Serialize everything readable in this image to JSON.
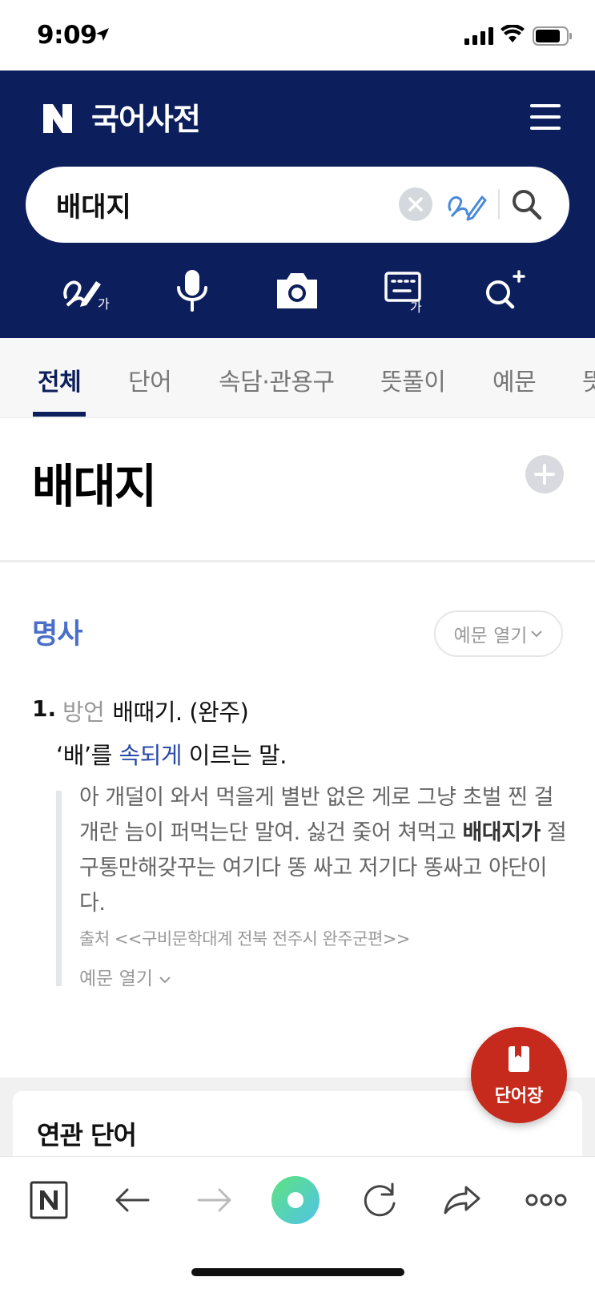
{
  "status": {
    "time": "9:09"
  },
  "header": {
    "logo": "N",
    "title": "국어사전",
    "search": {
      "value": "배대지"
    }
  },
  "tabs": [
    "전체",
    "단어",
    "속담·관용구",
    "뜻풀이",
    "예문",
    "뜻"
  ],
  "entry": {
    "word": "배대지",
    "pos": "명사",
    "example_toggle": "예문 열기",
    "definition": {
      "number": "1.",
      "dialect": "방언",
      "standard": "배때기. (완주)",
      "gloss_pre": "‘배’를 ",
      "gloss_link": "속되게",
      "gloss_post": " 이르는 말."
    },
    "example": {
      "text_pre": "아 개덜이 와서 먹을게 별반 없은 게로 그냥 초벌 찐 걸개란 늠이 퍼먹는단 말여. 싫건 줒어 쳐먹고 ",
      "text_bold": "배대지가",
      "text_post": " 절구통만해갖꾸는 여기다 똥 싸고 저기다 똥싸고 야단이다.",
      "source": "출처 <<구비문학대계 전북 전주시 완주군편>>",
      "more": "예문 열기"
    }
  },
  "related": {
    "title": "연관 단어"
  },
  "fab": {
    "label": "단어장"
  },
  "colors": {
    "header_bg": "#0c1f5c",
    "pos": "#4a6fc9",
    "fab": "#c62a1c",
    "link": "#2a4aa8"
  }
}
